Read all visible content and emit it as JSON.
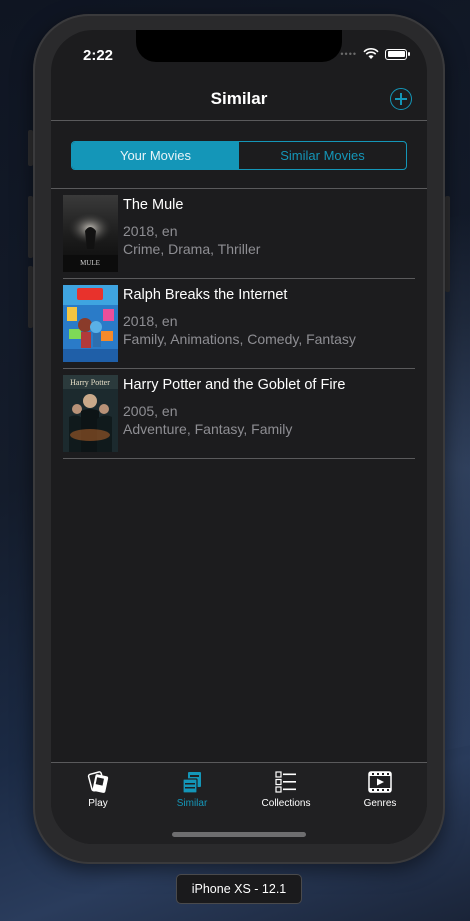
{
  "status_bar": {
    "time": "2:22"
  },
  "nav": {
    "title": "Similar"
  },
  "segment": {
    "options": [
      "Your Movies",
      "Similar Movies"
    ],
    "selected": "Your Movies"
  },
  "movies": [
    {
      "title": "The Mule",
      "year_lang": "2018, en",
      "genres": "Crime, Drama, Thriller",
      "poster_text": "MULE"
    },
    {
      "title": "Ralph Breaks the Internet",
      "year_lang": "2018, en",
      "genres": "Family, Animations, Comedy, Fantasy"
    },
    {
      "title": "Harry Potter and the Goblet of Fire",
      "year_lang": "2005, en",
      "genres": "Adventure, Fantasy, Family",
      "poster_text": "Harry Potter"
    }
  ],
  "tabs": [
    {
      "label": "Play",
      "icon": "cards-icon"
    },
    {
      "label": "Similar",
      "icon": "similar-icon",
      "active": true
    },
    {
      "label": "Collections",
      "icon": "checklist-icon"
    },
    {
      "label": "Genres",
      "icon": "film-icon"
    }
  ],
  "device_label": "iPhone XS - 12.1",
  "colors": {
    "accent": "#1496b8",
    "background": "#1c1c1e",
    "separator": "#5a5a5c"
  }
}
